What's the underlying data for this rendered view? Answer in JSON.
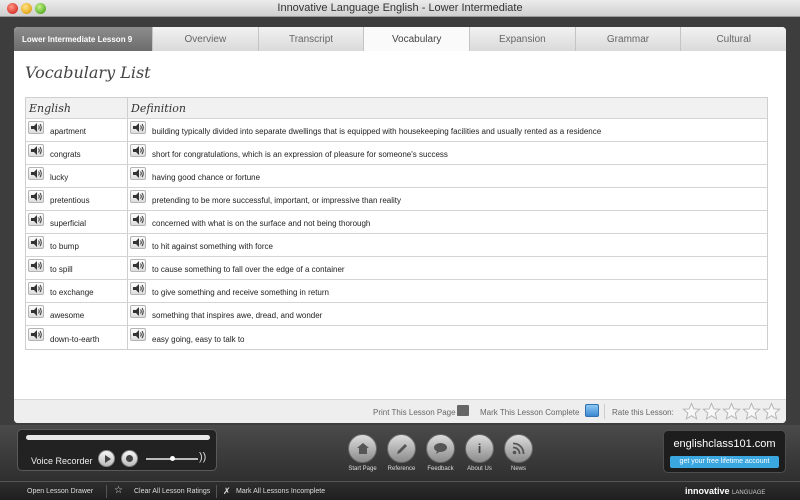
{
  "window": {
    "title": "Innovative Language English - Lower Intermediate"
  },
  "tabs": {
    "lesson_label": "Lower Intermediate Lesson 9",
    "items": [
      "Overview",
      "Transcript",
      "Vocabulary",
      "Expansion",
      "Grammar",
      "Cultural"
    ],
    "active": "Vocabulary"
  },
  "page": {
    "title": "Vocabulary List"
  },
  "table": {
    "headers": {
      "english": "English",
      "definition": "Definition"
    },
    "rows": [
      {
        "word": "apartment",
        "definition": "building typically divided into separate dwellings that is equipped with housekeeping facilities and usually rented as a residence"
      },
      {
        "word": "congrats",
        "definition": "short for congratulations, which is an expression of pleasure for someone's success"
      },
      {
        "word": "lucky",
        "definition": "having good chance or fortune"
      },
      {
        "word": "pretentious",
        "definition": "pretending to be more successful, important, or impressive than reality"
      },
      {
        "word": "superficial",
        "definition": "concerned with what is on the surface and not being thorough"
      },
      {
        "word": "to bump",
        "definition": "to hit against something with force"
      },
      {
        "word": "to spill",
        "definition": "to cause something to fall over the edge of a container"
      },
      {
        "word": "to exchange",
        "definition": "to give something and receive something in return"
      },
      {
        "word": "awesome",
        "definition": "something that inspires awe, dread, and wonder"
      },
      {
        "word": "down-to-earth",
        "definition": "easy going, easy to talk to"
      }
    ]
  },
  "footer": {
    "print_label": "Print This Lesson Page",
    "mark_label": "Mark This Lesson Complete",
    "rate_label": "Rate this Lesson:",
    "rating": 0,
    "rating_max": 5
  },
  "recorder": {
    "label": "Voice Recorder",
    "volume": 0.5
  },
  "nav": {
    "start": "Start Page",
    "reference": "Reference",
    "feedback": "Feedback",
    "about": "About Us",
    "news": "News"
  },
  "brand": {
    "name": "englishclass101.com",
    "cta": "get your free lifetime account"
  },
  "statusbar": {
    "open_drawer": "Open Lesson Drawer",
    "clear_ratings": "Clear All Lesson Ratings",
    "mark_incomplete": "Mark All Lessons Incomplete",
    "logo_main": "innovative",
    "logo_sub": "LANGUAGE"
  },
  "colors": {
    "accent_blue": "#3aa7e0",
    "tab_active": "#fafafa",
    "chrome_dark": "#2f2f2f"
  }
}
